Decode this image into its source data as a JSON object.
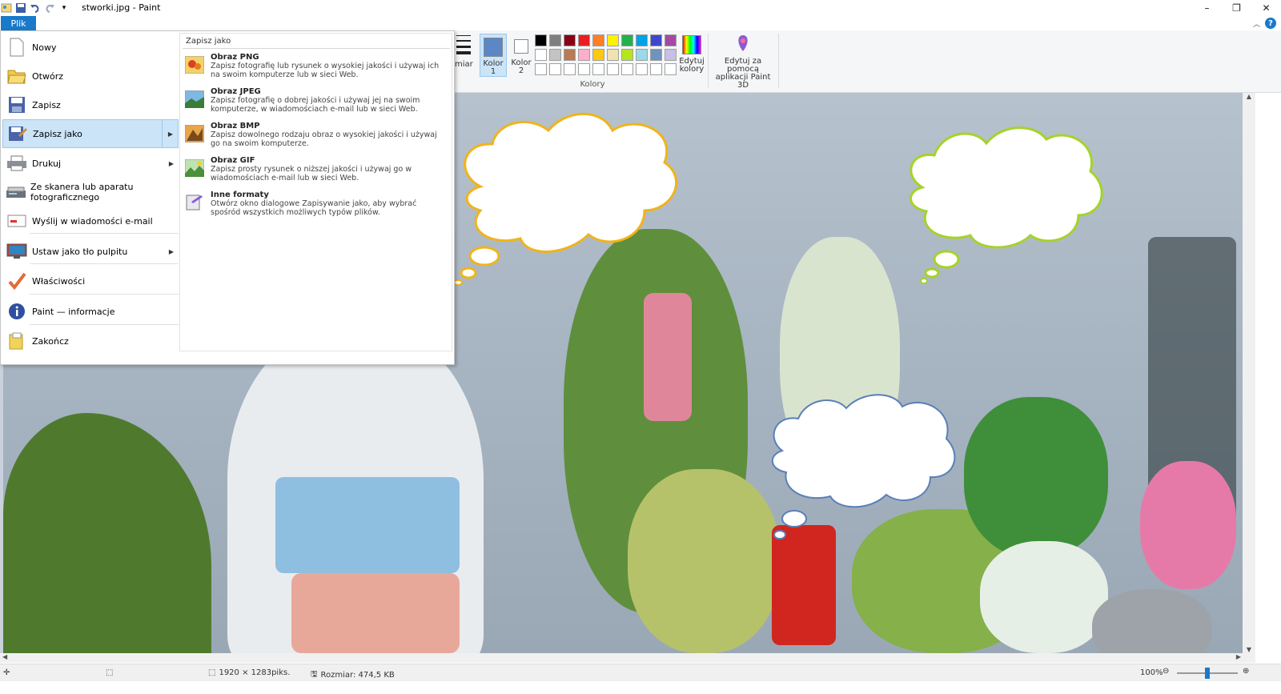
{
  "window": {
    "title": "stworki.jpg - Paint",
    "minimize": "–",
    "restore": "❐",
    "close": "✕"
  },
  "ribbon": {
    "file_tab": "Plik",
    "size_label": "miar",
    "color1_label": "Kolor 1",
    "color2_label": "Kolor 2",
    "colors_group": "Kolory",
    "edit_colors_label": "Edytuj kolory",
    "paint3d_label": "Edytuj za pomocą aplikacji Paint 3D",
    "color1": "#5b87c6",
    "color2": "#ffffff",
    "palette": [
      "#000000",
      "#7f7f7f",
      "#880015",
      "#ed1c24",
      "#ff7f27",
      "#fff200",
      "#22b14c",
      "#00a2e8",
      "#3f48cc",
      "#a349a4",
      "#ffffff",
      "#c3c3c3",
      "#b97a57",
      "#ffaec9",
      "#ffc90e",
      "#efe4b0",
      "#b5e61d",
      "#99d9ea",
      "#7092be",
      "#c8bfe7",
      "#ffffff",
      "#ffffff",
      "#ffffff",
      "#ffffff",
      "#ffffff",
      "#ffffff",
      "#ffffff",
      "#ffffff",
      "#ffffff",
      "#ffffff"
    ]
  },
  "file_menu": {
    "items": [
      {
        "label": "Nowy",
        "icon": "new-file-icon"
      },
      {
        "label": "Otwórz",
        "icon": "open-folder-icon"
      },
      {
        "label": "Zapisz",
        "icon": "save-disk-icon"
      },
      {
        "label": "Zapisz jako",
        "icon": "save-as-icon",
        "submenu": true,
        "selected": true
      },
      {
        "label": "Drukuj",
        "icon": "printer-icon",
        "submenu": true
      },
      {
        "label": "Ze skanera lub aparatu fotograficznego",
        "icon": "scanner-icon"
      },
      {
        "label": "Wyślij w wiadomości e-mail",
        "icon": "email-icon"
      },
      {
        "label": "Ustaw jako tło pulpitu",
        "icon": "desktop-background-icon",
        "submenu": true
      },
      {
        "label": "Właściwości",
        "icon": "checkmark-icon"
      },
      {
        "label": "Paint — informacje",
        "icon": "info-icon"
      },
      {
        "label": "Zakończ",
        "icon": "exit-icon"
      }
    ],
    "submenu": {
      "title": "Zapisz jako",
      "items": [
        {
          "title": "Obraz PNG",
          "desc": "Zapisz fotografię lub rysunek o wysokiej jakości i używaj ich na swoim komputerze lub w sieci Web.",
          "icon": "png-image-icon"
        },
        {
          "title": "Obraz JPEG",
          "desc": "Zapisz fotografię o dobrej jakości i używaj jej na swoim komputerze, w wiadomościach e-mail lub w sieci Web.",
          "icon": "jpeg-image-icon"
        },
        {
          "title": "Obraz BMP",
          "desc": "Zapisz dowolnego rodzaju obraz o wysokiej jakości i używaj go na swoim komputerze.",
          "icon": "bmp-image-icon"
        },
        {
          "title": "Obraz GIF",
          "desc": "Zapisz prosty rysunek o niższej jakości i używaj go w wiadomościach e-mail lub w sieci Web.",
          "icon": "gif-image-icon"
        },
        {
          "title": "Inne formaty",
          "desc": "Otwórz okno dialogowe Zapisywanie jako, aby wybrać spośród wszystkich możliwych typów plików.",
          "icon": "other-formats-icon"
        }
      ]
    }
  },
  "status": {
    "dimensions": "1920 × 1283piks.",
    "size": "Rozmiar: 474,5 KB",
    "zoom": "100%"
  }
}
